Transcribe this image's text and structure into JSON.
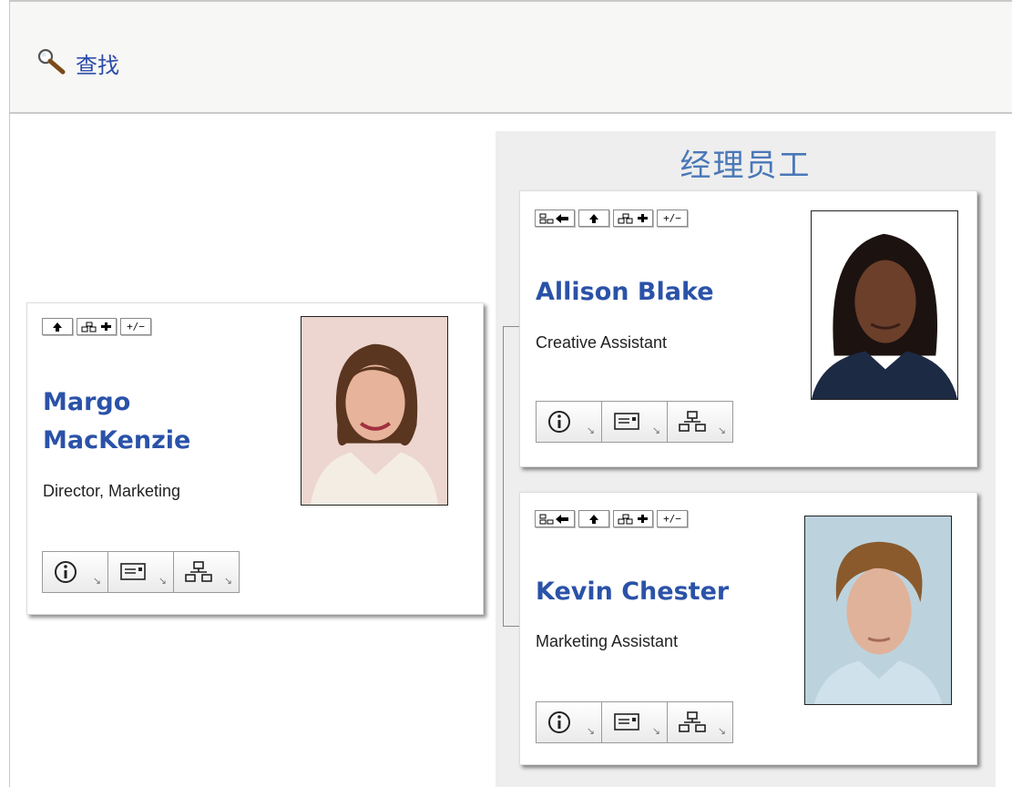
{
  "toolbar": {
    "find_label": "查找",
    "find_icon": "magnifier-icon"
  },
  "manager": {
    "name": "Margo MacKenzie",
    "name_line1": "Margo",
    "name_line2": "MacKenzie",
    "title": "Director, Marketing",
    "actions": [
      "up-arrow",
      "show-reports",
      "+/−"
    ]
  },
  "reports_panel": {
    "title": "经理员工"
  },
  "reports": [
    {
      "name": "Allison Blake",
      "title": "Creative Assistant",
      "actions": [
        "back-to-manager",
        "up-arrow",
        "show-reports",
        "+/−"
      ]
    },
    {
      "name": "Kevin Chester",
      "title": "Marketing Assistant",
      "actions": [
        "back-to-manager",
        "up-arrow",
        "show-reports",
        "+/−"
      ]
    }
  ],
  "button_labels": {
    "plus_minus": "+/−"
  },
  "bottom_tools": [
    "info-icon",
    "email-icon",
    "org-chart-icon"
  ],
  "colors": {
    "name_link": "#2a52a8",
    "panel_title": "#4a78b8",
    "panel_bg": "#eeeeee",
    "toolbar_bg": "#f7f7f5"
  }
}
